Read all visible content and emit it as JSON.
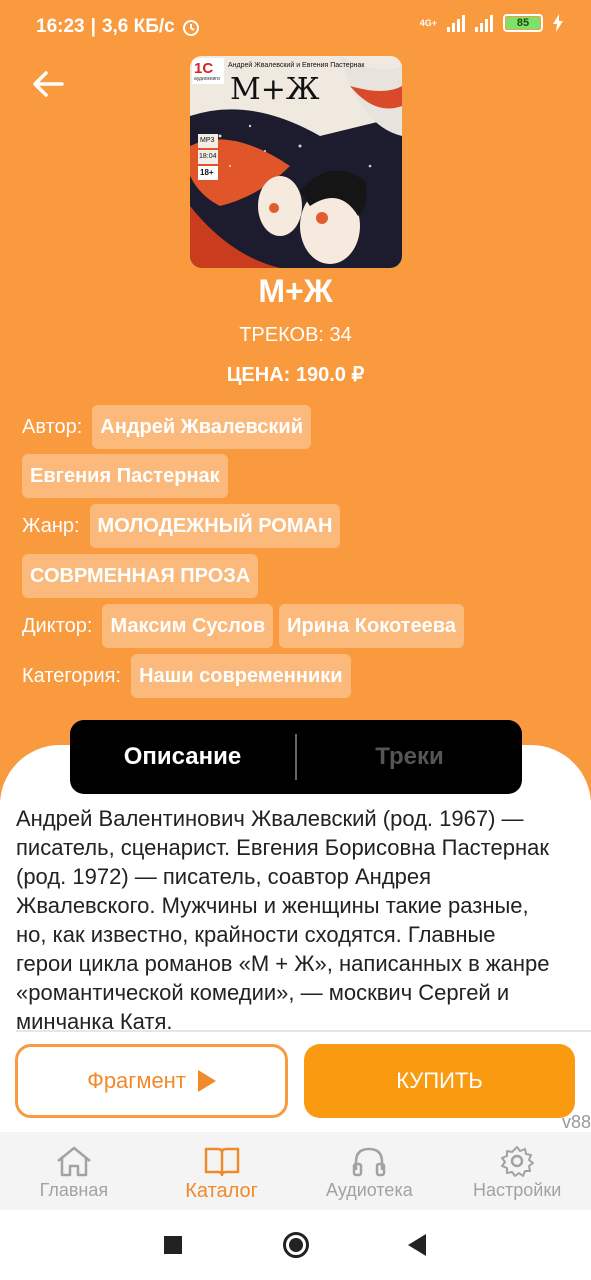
{
  "status_bar": {
    "time": "16:23",
    "speed": "3,6 КБ/с",
    "network": "4G+",
    "battery": "85"
  },
  "book": {
    "title": "М+Ж",
    "tracks": "ТРЕКОВ: 34",
    "price": "ЦЕНА: 190.0 ₽",
    "cover_texts": {
      "publisher": "1С",
      "publisher_sub": "аудиокниги",
      "authors_line": "Андрей Жвалевский и Евгения Пастернак",
      "title": "М+Ж",
      "format": "MP3",
      "duration": "18:04",
      "age": "18+"
    }
  },
  "meta": {
    "author_label": "Автор:",
    "authors": [
      "Андрей Жвалевский",
      "Евгения Пастернак"
    ],
    "genre_label": "Жанр:",
    "genres": [
      "МОЛОДЕЖНЫЙ РОМАН",
      "СОВРМЕННАЯ ПРОЗА"
    ],
    "narrator_label": "Диктор:",
    "narrators": [
      "Максим Суслов",
      "Ирина Кокотеева"
    ],
    "category_label": "Категория:",
    "categories": [
      "Наши современники"
    ]
  },
  "tabs": {
    "description": "Описание",
    "tracks": "Треки"
  },
  "description": "Андрей Валентинович Жвалевский (род. 1967) — писатель, сценарист. Евгения Борисовна Пастернак (род. 1972) — писатель, соавтор Андрея Жвалевского. Мужчины и женщины такие разные, но, как известно, крайности сходятся. Главные герои цикла романов «М + Ж», написанных в жанре «романтической комедии», — москвич Сергей и минчанка Катя.",
  "actions": {
    "fragment": "Фрагмент",
    "buy": "КУПИТЬ"
  },
  "version": "v88",
  "bottom_nav": {
    "items": [
      {
        "label": "Главная",
        "icon": "home-icon"
      },
      {
        "label": "Каталог",
        "icon": "book-icon",
        "active": true
      },
      {
        "label": "Аудиотека",
        "icon": "headphones-icon"
      },
      {
        "label": "Настройки",
        "icon": "gear-icon"
      }
    ]
  },
  "colors": {
    "accent": "#f99a3f",
    "chip": "#fbb97c",
    "buy": "#f99a10"
  }
}
